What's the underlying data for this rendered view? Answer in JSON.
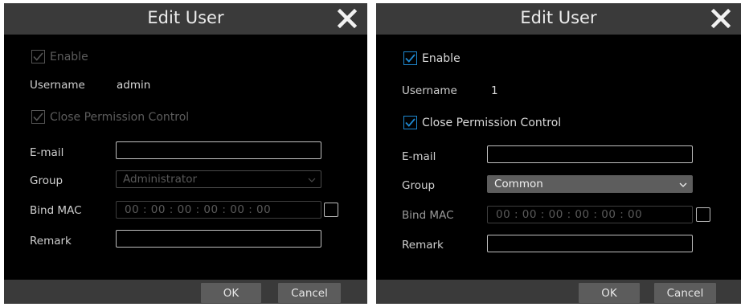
{
  "left": {
    "title": "Edit User",
    "enable_label": "Enable",
    "enable_checked": true,
    "username_label": "Username",
    "username_value": "admin",
    "close_permission_label": "Close Permission Control",
    "close_permission_checked": true,
    "email_label": "E-mail",
    "email_value": "",
    "group_label": "Group",
    "group_value": "Administrator",
    "bind_mac_label": "Bind MAC",
    "mac_value": "00 : 00 : 00 : 00 : 00 : 00",
    "remark_label": "Remark",
    "remark_value": "",
    "ok_label": "OK",
    "cancel_label": "Cancel"
  },
  "right": {
    "title": "Edit User",
    "enable_label": "Enable",
    "enable_checked": true,
    "username_label": "Username",
    "username_value": "1",
    "close_permission_label": "Close Permission Control",
    "close_permission_checked": true,
    "email_label": "E-mail",
    "email_value": "",
    "group_label": "Group",
    "group_value": "Common",
    "bind_mac_label": "Bind MAC",
    "mac_value": "00 : 00 : 00 : 00 : 00 : 00",
    "remark_label": "Remark",
    "remark_value": "",
    "ok_label": "OK",
    "cancel_label": "Cancel"
  },
  "colors": {
    "titlebar": "#3a3a3a",
    "background": "#000000",
    "accent_check": "#1e88d0",
    "button": "#5c5c5c"
  }
}
